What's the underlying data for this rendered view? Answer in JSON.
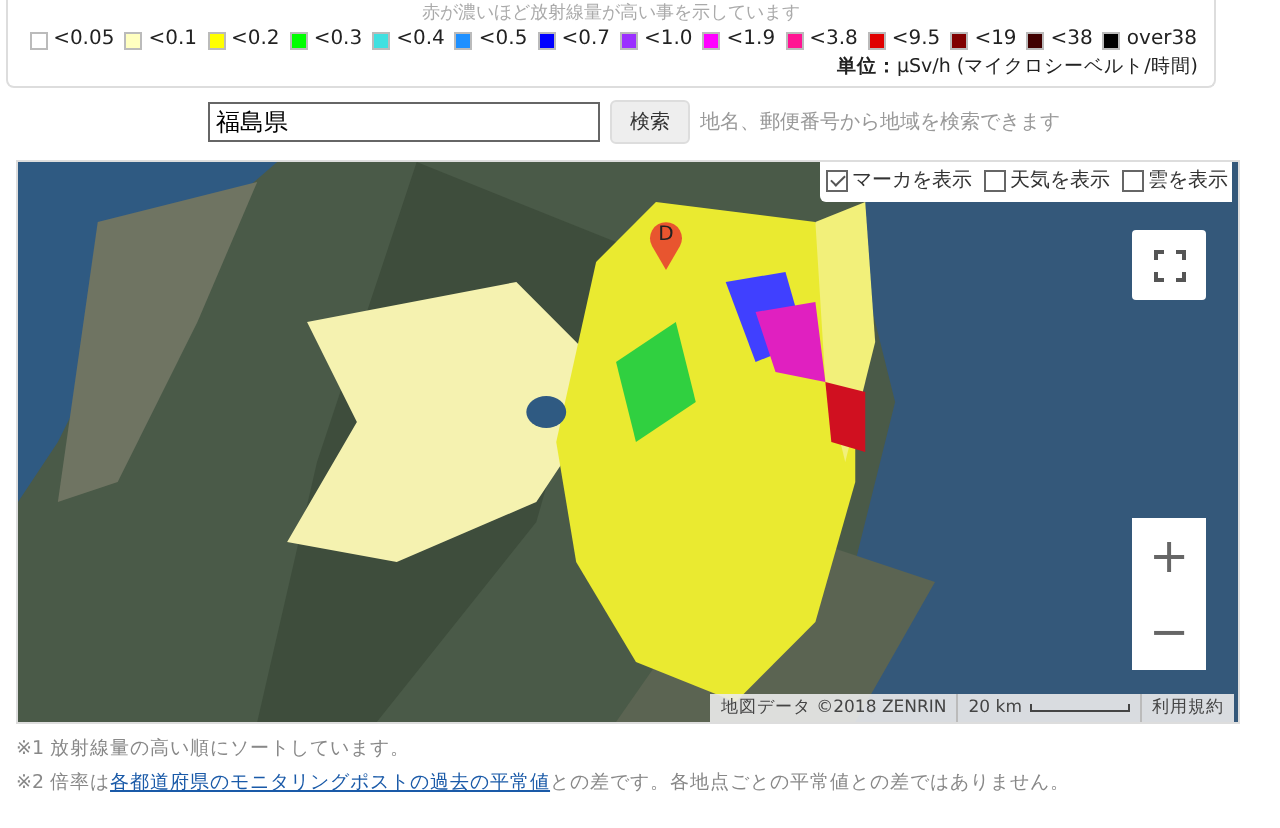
{
  "legend": {
    "caption": "赤が濃いほど放射線量が高い事を示しています",
    "items": [
      {
        "label": "<0.05",
        "color": "#ffffff"
      },
      {
        "label": "<0.1",
        "color": "#ffffc0"
      },
      {
        "label": "<0.2",
        "color": "#ffff00"
      },
      {
        "label": "<0.3",
        "color": "#00ff00"
      },
      {
        "label": "<0.4",
        "color": "#40e0e0"
      },
      {
        "label": "<0.5",
        "color": "#1e90ff"
      },
      {
        "label": "<0.7",
        "color": "#0000ff"
      },
      {
        "label": "<1.0",
        "color": "#9b30ff"
      },
      {
        "label": "<1.9",
        "color": "#ff00ff"
      },
      {
        "label": "<3.8",
        "color": "#ff1493"
      },
      {
        "label": "<9.5",
        "color": "#e00000"
      },
      {
        "label": "<19",
        "color": "#800000"
      },
      {
        "label": "<38",
        "color": "#400000"
      },
      {
        "label": "over38",
        "color": "#000000"
      }
    ],
    "unit_label": "単位：",
    "unit": "μSv/h (マイクロシーベルト/時間)"
  },
  "search": {
    "value": "福島県",
    "button": "検索",
    "hint": "地名、郵便番号から地域を検索できます"
  },
  "map": {
    "kind": "picture",
    "toggles": [
      {
        "label": "マーカを表示",
        "checked": true
      },
      {
        "label": "天気を表示",
        "checked": false
      },
      {
        "label": "雲を表示",
        "checked": false
      }
    ],
    "pin": "D",
    "zoom_in": "+",
    "zoom_out": "−",
    "attribution": "地図データ ©2018 ZENRIN",
    "scale": "20 km",
    "terms": "利用規約"
  },
  "notes": [
    {
      "mark": "※1",
      "text": "放射線量の高い順にソートしています。"
    },
    {
      "mark": "※2",
      "text": "倍率は",
      "link": "各都道府県のモニタリングポストの過去の平常値",
      "after": "との差です。各地点ごとの平常値との差ではありません。"
    }
  ]
}
